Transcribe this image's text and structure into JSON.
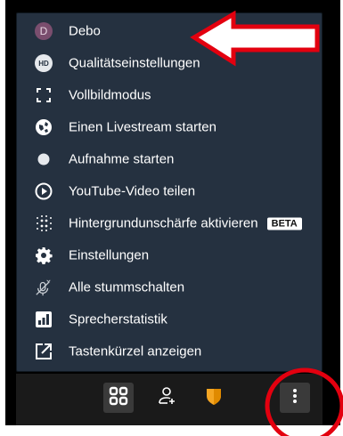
{
  "menu": {
    "items": [
      {
        "label": "Debo",
        "icon": "avatar-icon",
        "avatar_letter": "D"
      },
      {
        "label": "Qualitätseinstellungen",
        "icon": "hd-quality-icon",
        "icon_text": "HD"
      },
      {
        "label": "Vollbildmodus",
        "icon": "fullscreen-icon"
      },
      {
        "label": "Einen Livestream starten",
        "icon": "livestream-icon"
      },
      {
        "label": "Aufnahme starten",
        "icon": "record-icon"
      },
      {
        "label": "YouTube-Video teilen",
        "icon": "play-circle-icon"
      },
      {
        "label": "Hintergrundunschärfe aktivieren",
        "icon": "blur-icon",
        "badge": "BETA"
      },
      {
        "label": "Einstellungen",
        "icon": "gear-icon"
      },
      {
        "label": "Alle stummschalten",
        "icon": "mute-all-icon"
      },
      {
        "label": "Sprecherstatistik",
        "icon": "speaker-stats-icon"
      },
      {
        "label": "Tastenkürzel anzeigen",
        "icon": "shortcut-icon"
      }
    ]
  },
  "colors": {
    "menu_bg": "#253140",
    "annotation_red": "#e3000f",
    "shield_orange": "#f5a623"
  }
}
